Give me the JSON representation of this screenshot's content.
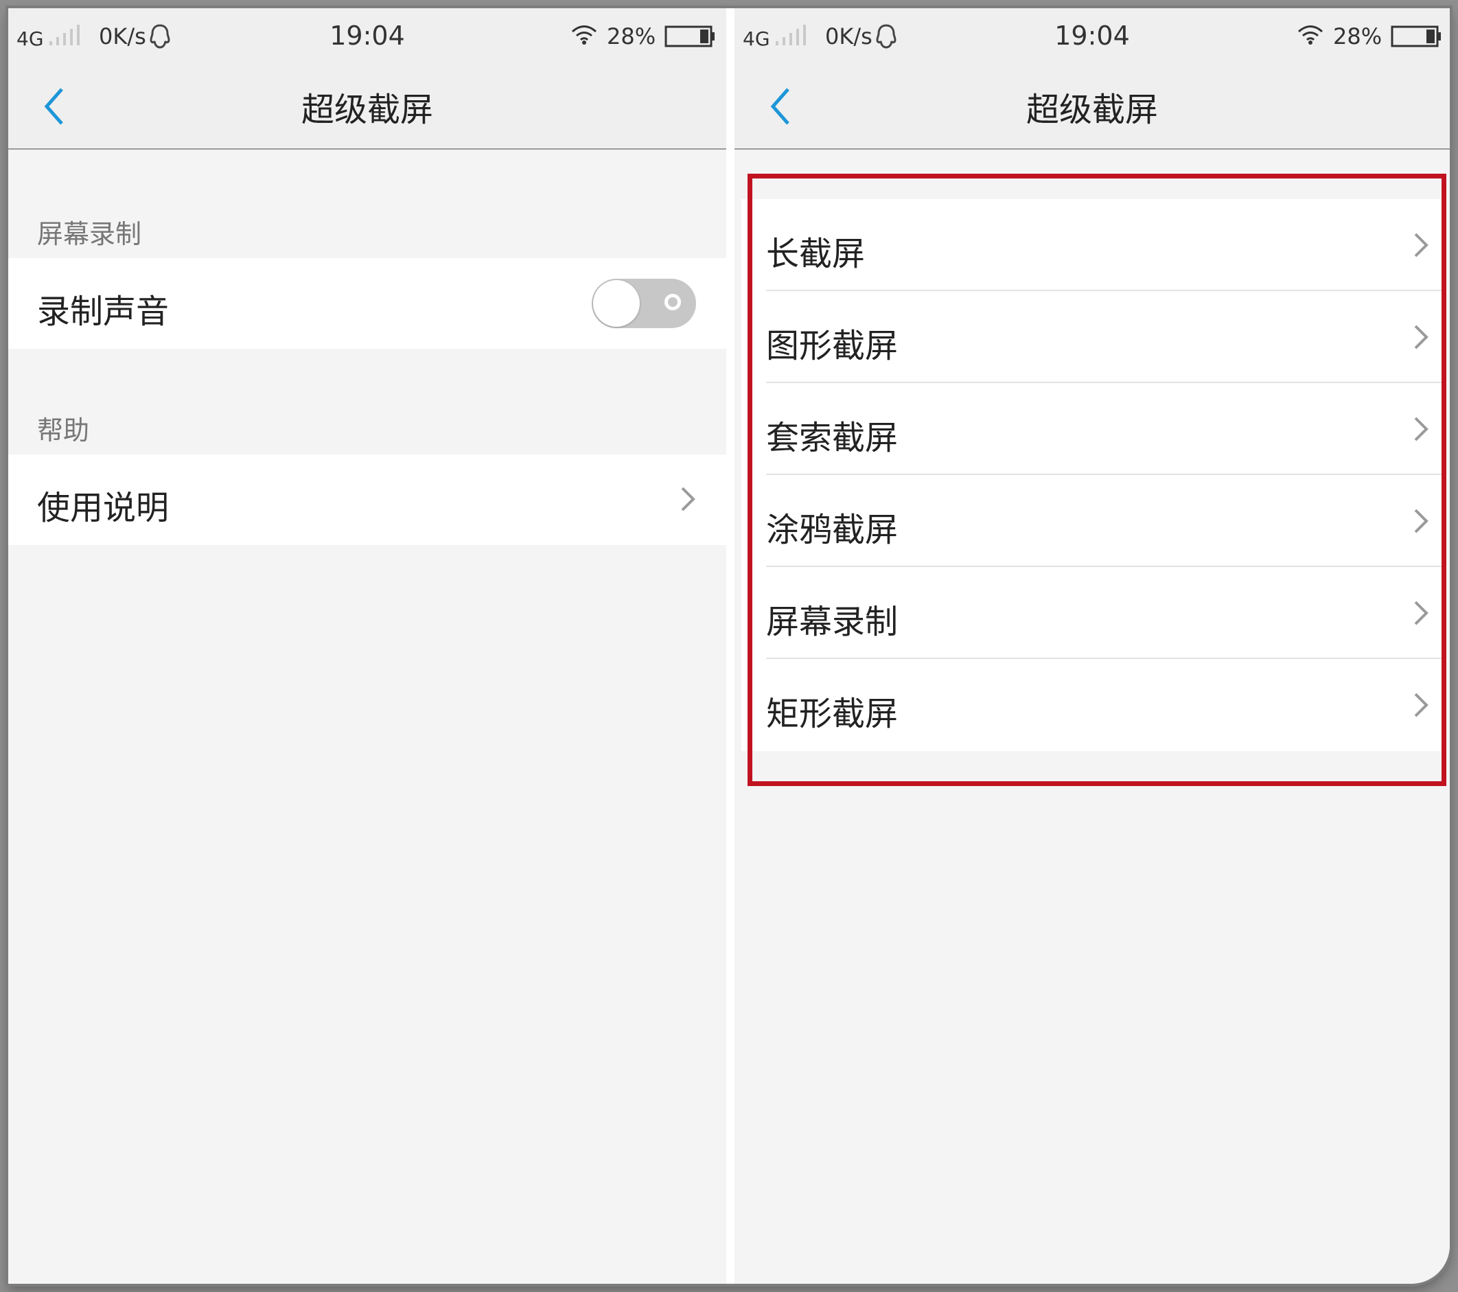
{
  "screens": [
    {
      "status_bar": {
        "network": "4G",
        "speed": "0K/s",
        "time": "19:04",
        "battery": "28%"
      },
      "header": {
        "title": "超级截屏"
      },
      "sections": {
        "screen_recording": "屏幕录制",
        "help": "帮助"
      },
      "rows": {
        "record_sound": "录制声音",
        "instructions": "使用说明"
      },
      "toggle": {
        "enabled": false
      }
    },
    {
      "status_bar": {
        "network": "4G",
        "speed": "0K/s",
        "time": "19:04",
        "battery": "28%"
      },
      "header": {
        "title": "超级截屏"
      },
      "items": [
        {
          "label": "长截屏"
        },
        {
          "label": "图形截屏"
        },
        {
          "label": "套索截屏"
        },
        {
          "label": "涂鸦截屏"
        },
        {
          "label": "屏幕录制"
        },
        {
          "label": "矩形截屏"
        }
      ]
    }
  ],
  "colors": {
    "accent": "#1d96d8",
    "highlight": "#c1121f",
    "text": "#222222",
    "secondary_text": "#777777"
  },
  "icons": {
    "back": "chevron-left-icon",
    "row": "chevron-right-icon",
    "network": "signal-icon",
    "wifi": "wifi-icon",
    "battery": "battery-icon",
    "qq": "qq-icon"
  }
}
